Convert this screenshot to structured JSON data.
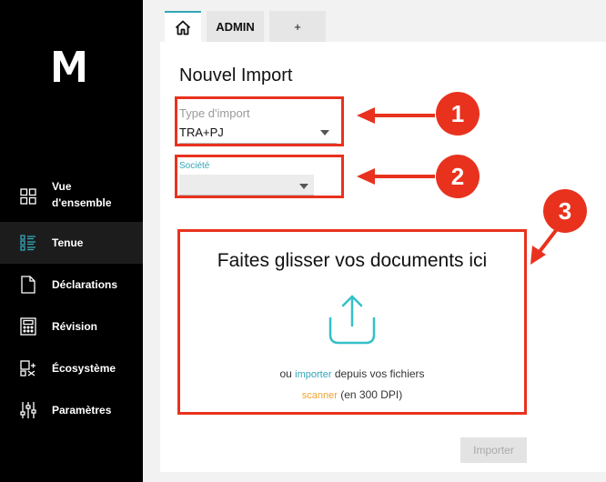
{
  "sidebar": {
    "items": [
      {
        "label_line1": "Vue",
        "label_line2": "d'ensemble",
        "icon": "grid-icon"
      },
      {
        "label": "Tenue",
        "icon": "list-icon"
      },
      {
        "label": "Déclarations",
        "icon": "document-icon"
      },
      {
        "label": "Révision",
        "icon": "calculator-icon"
      },
      {
        "label": "Écosystème",
        "icon": "ecosystem-icon"
      },
      {
        "label": "Paramètres",
        "icon": "sliders-icon"
      }
    ]
  },
  "tabs": {
    "home_icon": "home-icon",
    "admin": "ADMIN",
    "plus": "+"
  },
  "form": {
    "title": "Nouvel Import",
    "type_label": "Type d'import",
    "type_value": "TRA+PJ",
    "societe_label": "Société",
    "societe_value": ""
  },
  "dropzone": {
    "title": "Faites glisser vos documents ici",
    "prefix": "ou",
    "importer_link": "importer",
    "suffix": "depuis vos fichiers",
    "scanner_link": "scanner",
    "scanner_suffix": "(en 300 DPI)"
  },
  "import_button": "Importer",
  "annotations": {
    "badge1": "1",
    "badge2": "2",
    "badge3": "3",
    "color": "#e8321e"
  },
  "colors": {
    "accent": "#34a6b8",
    "scanner": "#f0a530",
    "sidebar_bg": "#000000"
  }
}
